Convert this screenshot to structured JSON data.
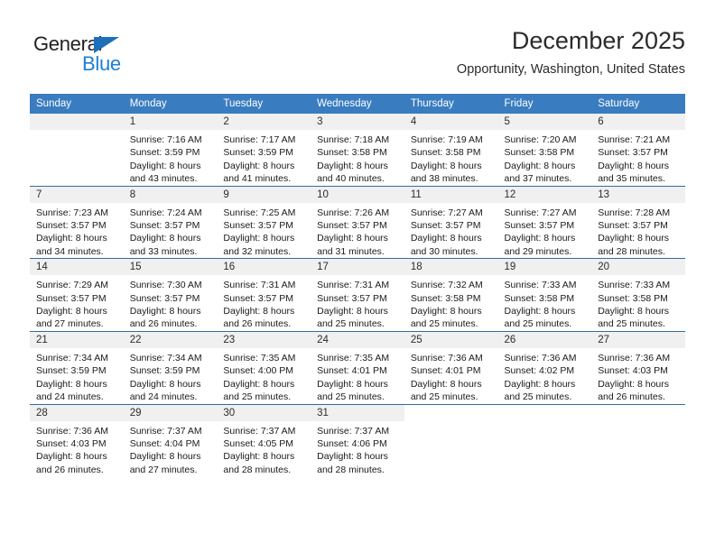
{
  "brand": {
    "name_top": "General",
    "name_bottom": "Blue",
    "accent_color": "#1c7fd6",
    "triangle_color": "#1c6fba"
  },
  "header": {
    "title": "December 2025",
    "subtitle": "Opportunity, Washington, United States"
  },
  "calendar": {
    "header_bg": "#3a7cc0",
    "daynum_bg": "#f0f0f0",
    "row_border_color": "#2e6da4",
    "weekday_headers": [
      "Sunday",
      "Monday",
      "Tuesday",
      "Wednesday",
      "Thursday",
      "Friday",
      "Saturday"
    ],
    "weeks": [
      [
        {
          "day": "",
          "sunrise": "",
          "sunset": "",
          "daylight_line1": "",
          "daylight_line2": "",
          "empty": true
        },
        {
          "day": "1",
          "sunrise": "Sunrise: 7:16 AM",
          "sunset": "Sunset: 3:59 PM",
          "daylight_line1": "Daylight: 8 hours",
          "daylight_line2": "and 43 minutes."
        },
        {
          "day": "2",
          "sunrise": "Sunrise: 7:17 AM",
          "sunset": "Sunset: 3:59 PM",
          "daylight_line1": "Daylight: 8 hours",
          "daylight_line2": "and 41 minutes."
        },
        {
          "day": "3",
          "sunrise": "Sunrise: 7:18 AM",
          "sunset": "Sunset: 3:58 PM",
          "daylight_line1": "Daylight: 8 hours",
          "daylight_line2": "and 40 minutes."
        },
        {
          "day": "4",
          "sunrise": "Sunrise: 7:19 AM",
          "sunset": "Sunset: 3:58 PM",
          "daylight_line1": "Daylight: 8 hours",
          "daylight_line2": "and 38 minutes."
        },
        {
          "day": "5",
          "sunrise": "Sunrise: 7:20 AM",
          "sunset": "Sunset: 3:58 PM",
          "daylight_line1": "Daylight: 8 hours",
          "daylight_line2": "and 37 minutes."
        },
        {
          "day": "6",
          "sunrise": "Sunrise: 7:21 AM",
          "sunset": "Sunset: 3:57 PM",
          "daylight_line1": "Daylight: 8 hours",
          "daylight_line2": "and 35 minutes."
        }
      ],
      [
        {
          "day": "7",
          "sunrise": "Sunrise: 7:23 AM",
          "sunset": "Sunset: 3:57 PM",
          "daylight_line1": "Daylight: 8 hours",
          "daylight_line2": "and 34 minutes."
        },
        {
          "day": "8",
          "sunrise": "Sunrise: 7:24 AM",
          "sunset": "Sunset: 3:57 PM",
          "daylight_line1": "Daylight: 8 hours",
          "daylight_line2": "and 33 minutes."
        },
        {
          "day": "9",
          "sunrise": "Sunrise: 7:25 AM",
          "sunset": "Sunset: 3:57 PM",
          "daylight_line1": "Daylight: 8 hours",
          "daylight_line2": "and 32 minutes."
        },
        {
          "day": "10",
          "sunrise": "Sunrise: 7:26 AM",
          "sunset": "Sunset: 3:57 PM",
          "daylight_line1": "Daylight: 8 hours",
          "daylight_line2": "and 31 minutes."
        },
        {
          "day": "11",
          "sunrise": "Sunrise: 7:27 AM",
          "sunset": "Sunset: 3:57 PM",
          "daylight_line1": "Daylight: 8 hours",
          "daylight_line2": "and 30 minutes."
        },
        {
          "day": "12",
          "sunrise": "Sunrise: 7:27 AM",
          "sunset": "Sunset: 3:57 PM",
          "daylight_line1": "Daylight: 8 hours",
          "daylight_line2": "and 29 minutes."
        },
        {
          "day": "13",
          "sunrise": "Sunrise: 7:28 AM",
          "sunset": "Sunset: 3:57 PM",
          "daylight_line1": "Daylight: 8 hours",
          "daylight_line2": "and 28 minutes."
        }
      ],
      [
        {
          "day": "14",
          "sunrise": "Sunrise: 7:29 AM",
          "sunset": "Sunset: 3:57 PM",
          "daylight_line1": "Daylight: 8 hours",
          "daylight_line2": "and 27 minutes."
        },
        {
          "day": "15",
          "sunrise": "Sunrise: 7:30 AM",
          "sunset": "Sunset: 3:57 PM",
          "daylight_line1": "Daylight: 8 hours",
          "daylight_line2": "and 26 minutes."
        },
        {
          "day": "16",
          "sunrise": "Sunrise: 7:31 AM",
          "sunset": "Sunset: 3:57 PM",
          "daylight_line1": "Daylight: 8 hours",
          "daylight_line2": "and 26 minutes."
        },
        {
          "day": "17",
          "sunrise": "Sunrise: 7:31 AM",
          "sunset": "Sunset: 3:57 PM",
          "daylight_line1": "Daylight: 8 hours",
          "daylight_line2": "and 25 minutes."
        },
        {
          "day": "18",
          "sunrise": "Sunrise: 7:32 AM",
          "sunset": "Sunset: 3:58 PM",
          "daylight_line1": "Daylight: 8 hours",
          "daylight_line2": "and 25 minutes."
        },
        {
          "day": "19",
          "sunrise": "Sunrise: 7:33 AM",
          "sunset": "Sunset: 3:58 PM",
          "daylight_line1": "Daylight: 8 hours",
          "daylight_line2": "and 25 minutes."
        },
        {
          "day": "20",
          "sunrise": "Sunrise: 7:33 AM",
          "sunset": "Sunset: 3:58 PM",
          "daylight_line1": "Daylight: 8 hours",
          "daylight_line2": "and 25 minutes."
        }
      ],
      [
        {
          "day": "21",
          "sunrise": "Sunrise: 7:34 AM",
          "sunset": "Sunset: 3:59 PM",
          "daylight_line1": "Daylight: 8 hours",
          "daylight_line2": "and 24 minutes."
        },
        {
          "day": "22",
          "sunrise": "Sunrise: 7:34 AM",
          "sunset": "Sunset: 3:59 PM",
          "daylight_line1": "Daylight: 8 hours",
          "daylight_line2": "and 24 minutes."
        },
        {
          "day": "23",
          "sunrise": "Sunrise: 7:35 AM",
          "sunset": "Sunset: 4:00 PM",
          "daylight_line1": "Daylight: 8 hours",
          "daylight_line2": "and 25 minutes."
        },
        {
          "day": "24",
          "sunrise": "Sunrise: 7:35 AM",
          "sunset": "Sunset: 4:01 PM",
          "daylight_line1": "Daylight: 8 hours",
          "daylight_line2": "and 25 minutes."
        },
        {
          "day": "25",
          "sunrise": "Sunrise: 7:36 AM",
          "sunset": "Sunset: 4:01 PM",
          "daylight_line1": "Daylight: 8 hours",
          "daylight_line2": "and 25 minutes."
        },
        {
          "day": "26",
          "sunrise": "Sunrise: 7:36 AM",
          "sunset": "Sunset: 4:02 PM",
          "daylight_line1": "Daylight: 8 hours",
          "daylight_line2": "and 25 minutes."
        },
        {
          "day": "27",
          "sunrise": "Sunrise: 7:36 AM",
          "sunset": "Sunset: 4:03 PM",
          "daylight_line1": "Daylight: 8 hours",
          "daylight_line2": "and 26 minutes."
        }
      ],
      [
        {
          "day": "28",
          "sunrise": "Sunrise: 7:36 AM",
          "sunset": "Sunset: 4:03 PM",
          "daylight_line1": "Daylight: 8 hours",
          "daylight_line2": "and 26 minutes."
        },
        {
          "day": "29",
          "sunrise": "Sunrise: 7:37 AM",
          "sunset": "Sunset: 4:04 PM",
          "daylight_line1": "Daylight: 8 hours",
          "daylight_line2": "and 27 minutes."
        },
        {
          "day": "30",
          "sunrise": "Sunrise: 7:37 AM",
          "sunset": "Sunset: 4:05 PM",
          "daylight_line1": "Daylight: 8 hours",
          "daylight_line2": "and 28 minutes."
        },
        {
          "day": "31",
          "sunrise": "Sunrise: 7:37 AM",
          "sunset": "Sunset: 4:06 PM",
          "daylight_line1": "Daylight: 8 hours",
          "daylight_line2": "and 28 minutes."
        },
        {
          "day": "",
          "sunrise": "",
          "sunset": "",
          "daylight_line1": "",
          "daylight_line2": "",
          "blank": true
        },
        {
          "day": "",
          "sunrise": "",
          "sunset": "",
          "daylight_line1": "",
          "daylight_line2": "",
          "blank": true
        },
        {
          "day": "",
          "sunrise": "",
          "sunset": "",
          "daylight_line1": "",
          "daylight_line2": "",
          "blank": true
        }
      ]
    ]
  }
}
